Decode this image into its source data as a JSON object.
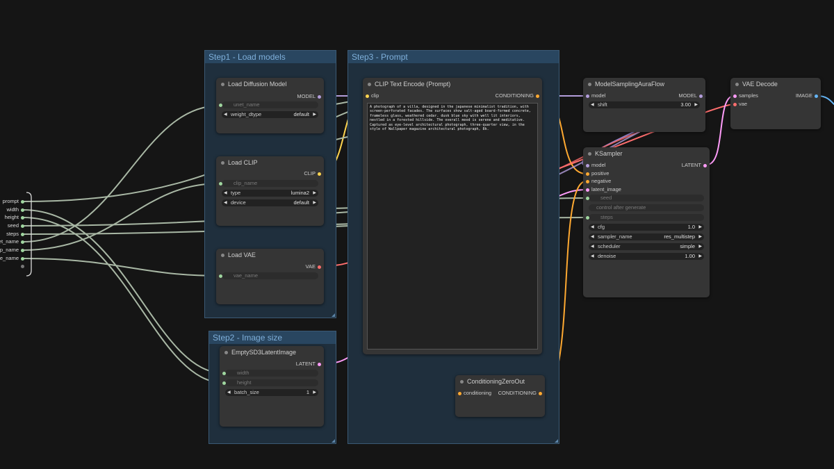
{
  "groups": {
    "step1": "Step1 - Load models",
    "step2": "Step2 - Image size",
    "step3": "Step3 - Prompt"
  },
  "reroute": {
    "labels": [
      "prompt",
      "width",
      "height",
      "seed",
      "steps",
      "unet_name",
      "clip_name",
      "vae_name"
    ],
    "visible": [
      "prompt",
      "width",
      "height",
      "seed",
      "steps",
      "unet_name",
      "ip_name",
      "ae_name"
    ]
  },
  "load_diffusion": {
    "title": "Load Diffusion Model",
    "out_model": "MODEL",
    "unet_name": "unet_name",
    "weight_dtype_label": "weight_dtype",
    "weight_dtype_value": "default"
  },
  "load_clip": {
    "title": "Load CLIP",
    "out_clip": "CLIP",
    "clip_name": "clip_name",
    "type_label": "type",
    "type_value": "lumina2",
    "device_label": "device",
    "device_value": "default"
  },
  "load_vae": {
    "title": "Load VAE",
    "out_vae": "VAE",
    "vae_name": "vae_name"
  },
  "empty_latent": {
    "title": "EmptySD3LatentImage",
    "out_latent": "LATENT",
    "width": "width",
    "height": "height",
    "batch_label": "batch_size",
    "batch_value": "1"
  },
  "clip_encode": {
    "title": "CLIP Text Encode (Prompt)",
    "in_clip": "clip",
    "out_conditioning": "CONDITIONING",
    "prompt": "A photograph of a villa, designed in the japanese minimalist tradition, with screen-perforated facades. The surfaces show salt-aged board-formed concrete, frameless glass, weathered cedar. dusk blue sky with well lit interiors, nestled in a forested hillside. The overall mood is serene and meditative. Captured as eye-level architectural photograph, three-quarter view, in the style of Wallpaper magazine architectural photograph, 8k."
  },
  "cond_zero": {
    "title": "ConditioningZeroOut",
    "in_conditioning": "conditioning",
    "out_conditioning": "CONDITIONING"
  },
  "model_sampling": {
    "title": "ModelSamplingAuraFlow",
    "in_model": "model",
    "out_model": "MODEL",
    "shift_label": "shift",
    "shift_value": "3.00"
  },
  "vae_decode": {
    "title": "VAE Decode",
    "in_samples": "samples",
    "in_vae": "vae",
    "out_image": "IMAGE"
  },
  "ksampler": {
    "title": "KSampler",
    "in_model": "model",
    "in_positive": "positive",
    "in_negative": "negative",
    "in_latent": "latent_image",
    "out_latent": "LATENT",
    "seed": "seed",
    "control": "control after generate",
    "steps": "steps",
    "cfg_label": "cfg",
    "cfg_value": "1.0",
    "sampler_label": "sampler_name",
    "sampler_value": "res_multistep",
    "scheduler_label": "scheduler",
    "scheduler_value": "simple",
    "denoise_label": "denoise",
    "denoise_value": "1.00"
  },
  "colors": {
    "model": "#b39ddb",
    "clip": "#ffd54f",
    "vae": "#ff6e6e",
    "latent": "#ff9cf9",
    "conditioning": "#ffa931",
    "primitive": "#9fd69f",
    "image": "#64b5f6"
  }
}
